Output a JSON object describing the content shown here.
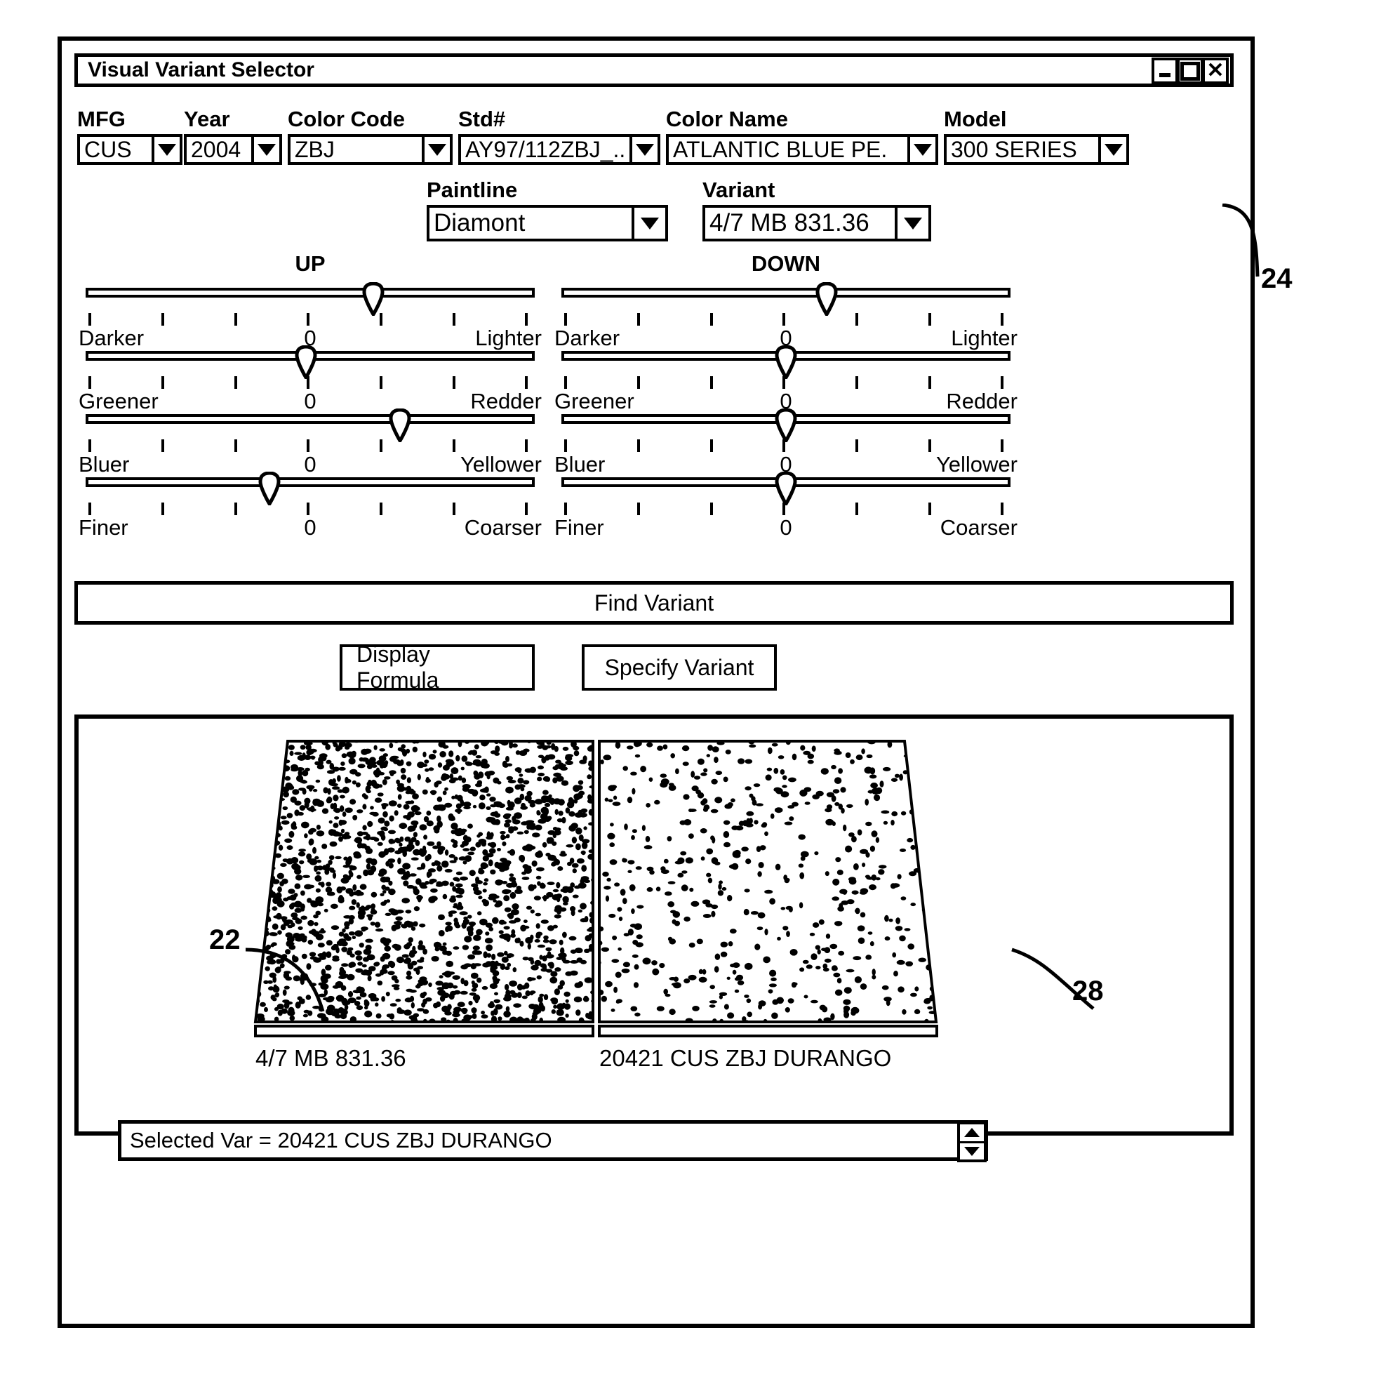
{
  "window": {
    "title": "Visual Variant Selector",
    "buttons": {
      "minimize": "minimize",
      "maximize": "maximize",
      "close": "✕"
    }
  },
  "fields_row1": [
    {
      "label": "MFG",
      "value": "CUS"
    },
    {
      "label": "Year",
      "value": "2004"
    },
    {
      "label": "Color Code",
      "value": "ZBJ"
    },
    {
      "label": "Std#",
      "value": "AY97/112ZBJ_.."
    },
    {
      "label": "Color Name",
      "value": "ATLANTIC BLUE PE."
    },
    {
      "label": "Model",
      "value": "300 SERIES"
    }
  ],
  "fields_row2": [
    {
      "label": "Paintline",
      "value": "Diamont"
    },
    {
      "label": "Variant",
      "value": "4/7 MB 831.36"
    }
  ],
  "sliders": {
    "up": {
      "title": "UP",
      "rows": [
        {
          "left": "Darker",
          "center": "0",
          "right": "Lighter",
          "position": 64
        },
        {
          "left": "Greener",
          "center": "0",
          "right": "Redder",
          "position": 49
        },
        {
          "left": "Bluer",
          "center": "0",
          "right": "Yellower",
          "position": 70
        },
        {
          "left": "Finer",
          "center": "0",
          "right": "Coarser",
          "position": 41
        }
      ]
    },
    "down": {
      "title": "DOWN",
      "rows": [
        {
          "left": "Darker",
          "center": "0",
          "right": "Lighter",
          "position": 59
        },
        {
          "left": "Greener",
          "center": "0",
          "right": "Redder",
          "position": 50
        },
        {
          "left": "Bluer",
          "center": "0",
          "right": "Yellower",
          "position": 50
        },
        {
          "left": "Finer",
          "center": "0",
          "right": "Coarser",
          "position": 50
        }
      ]
    },
    "tick_positions": [
      1,
      17.2,
      33.4,
      49.6,
      65.8,
      82,
      98.2
    ]
  },
  "buttons": {
    "find_variant": "Find Variant",
    "display_formula": "Display Formula",
    "specify_variant": "Specify Variant"
  },
  "swatches": {
    "left": {
      "caption": "4/7 MB 831.36",
      "density": "high"
    },
    "right": {
      "caption": "20421 CUS ZBJ DURANGO",
      "density": "low"
    }
  },
  "selected_var": {
    "text": "Selected Var = 20421 CUS ZBJ DURANGO"
  },
  "callouts": [
    {
      "id": "24",
      "label": "24"
    },
    {
      "id": "22",
      "label": "22"
    },
    {
      "id": "28",
      "label": "28"
    }
  ]
}
